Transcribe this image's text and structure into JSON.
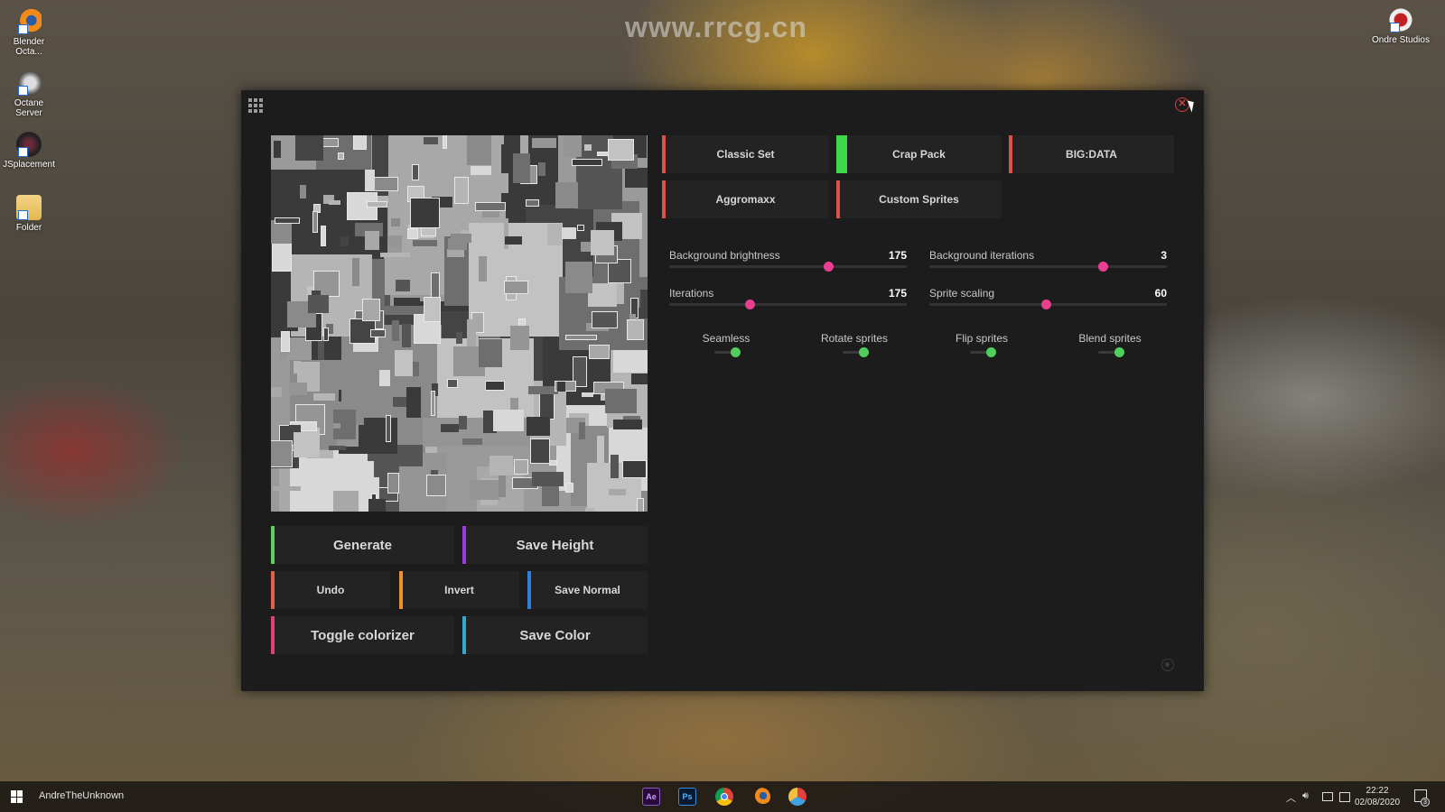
{
  "desktop": {
    "watermark": "www.rrcg.cn",
    "icons": [
      {
        "label": "Blender Octa...",
        "icon": "blender-icon"
      },
      {
        "label": "Octane Server",
        "icon": "octane-icon"
      },
      {
        "label": "JSplacement",
        "icon": "jsplacement-icon"
      },
      {
        "label": "Folder",
        "icon": "folder-icon"
      },
      {
        "label": "Ondre Studios",
        "icon": "ondre-studios-icon"
      }
    ]
  },
  "app": {
    "close_symbol": "✕",
    "packs": [
      {
        "label": "Classic Set",
        "color": "#e0504a",
        "active": false
      },
      {
        "label": "Crap Pack",
        "color": "#3fd84a",
        "active": true
      },
      {
        "label": "BIG:DATA",
        "color": "#e0504a",
        "active": false
      },
      {
        "label": "Aggromaxx",
        "color": "#e0504a",
        "active": false
      },
      {
        "label": "Custom Sprites",
        "color": "#e0504a",
        "active": false
      }
    ],
    "sliders": [
      {
        "label": "Background brightness",
        "value": "175",
        "fraction": 0.67
      },
      {
        "label": "Background iterations",
        "value": "3",
        "fraction": 0.73
      },
      {
        "label": "Iterations",
        "value": "175",
        "fraction": 0.34
      },
      {
        "label": "Sprite scaling",
        "value": "60",
        "fraction": 0.49
      }
    ],
    "toggles": [
      {
        "label": "Seamless",
        "on": true
      },
      {
        "label": "Rotate sprites",
        "on": true
      },
      {
        "label": "Flip sprites",
        "on": true
      },
      {
        "label": "Blend sprites",
        "on": true
      }
    ],
    "buttons": {
      "generate": {
        "label": "Generate",
        "color": "#5ccf5c"
      },
      "save_height": {
        "label": "Save Height",
        "color": "#9a3be0"
      },
      "undo": {
        "label": "Undo",
        "color": "#e0604a"
      },
      "invert": {
        "label": "Invert",
        "color": "#f0902a"
      },
      "save_normal": {
        "label": "Save Normal",
        "color": "#2f7fe0"
      },
      "toggle_colorizer": {
        "label": "Toggle colorizer",
        "color": "#e0407a"
      },
      "save_color": {
        "label": "Save Color",
        "color": "#30a8d0"
      }
    }
  },
  "taskbar": {
    "user": "AndreTheUnknown",
    "apps": [
      {
        "label": "Ae",
        "icon": "after-effects-icon"
      },
      {
        "label": "Ps",
        "icon": "photoshop-icon"
      },
      {
        "label": "",
        "icon": "chrome-icon"
      },
      {
        "label": "",
        "icon": "blender-icon"
      },
      {
        "label": "",
        "icon": "davinci-resolve-icon"
      }
    ],
    "time": "22:22",
    "date": "02/08/2020",
    "notification_count": "3"
  }
}
